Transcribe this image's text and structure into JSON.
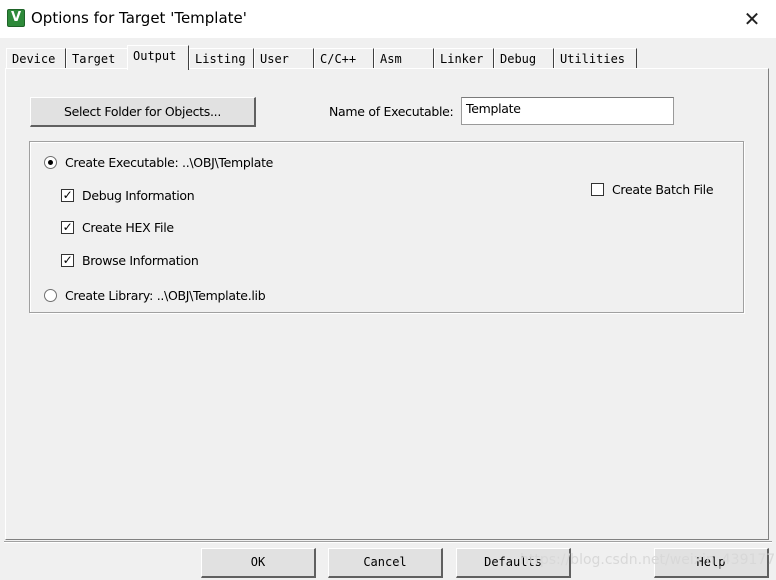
{
  "window": {
    "title": "Options for Target 'Template'",
    "app_icon_letter": "V",
    "close_glyph": "✕"
  },
  "tabs": [
    {
      "label": "Device",
      "active": false
    },
    {
      "label": "Target",
      "active": false
    },
    {
      "label": "Output",
      "active": true
    },
    {
      "label": "Listing",
      "active": false
    },
    {
      "label": "User",
      "active": false
    },
    {
      "label": "C/C++",
      "active": false
    },
    {
      "label": "Asm",
      "active": false
    },
    {
      "label": "Linker",
      "active": false
    },
    {
      "label": "Debug",
      "active": false
    },
    {
      "label": "Utilities",
      "active": false
    }
  ],
  "output": {
    "select_folder_label": "Select Folder for Objects...",
    "exe_name_label": "Name of Executable:",
    "exe_name_value": "Template",
    "create_executable_label": "Create Executable:  ..\\OBJ\\Template",
    "create_executable_selected": true,
    "debug_info_label": "Debug Information",
    "debug_info_checked": true,
    "create_hex_label": "Create HEX File",
    "create_hex_checked": true,
    "browse_info_label": "Browse Information",
    "browse_info_checked": true,
    "create_library_label": "Create Library:  ..\\OBJ\\Template.lib",
    "create_library_selected": false,
    "create_batch_label": "Create Batch File",
    "create_batch_checked": false
  },
  "buttons": {
    "ok": "OK",
    "cancel": "Cancel",
    "defaults": "Defaults",
    "help": "Help"
  },
  "watermark": "https://blog.csdn.net/weixin_43917735",
  "icons": {
    "app": "keil-uvision-icon",
    "close": "close-icon",
    "check": "checkmark-icon"
  },
  "colors": {
    "dialog_bg": "#f0f0f0",
    "titlebar_bg": "#ffffff",
    "app_icon": "#2e8a3a"
  }
}
